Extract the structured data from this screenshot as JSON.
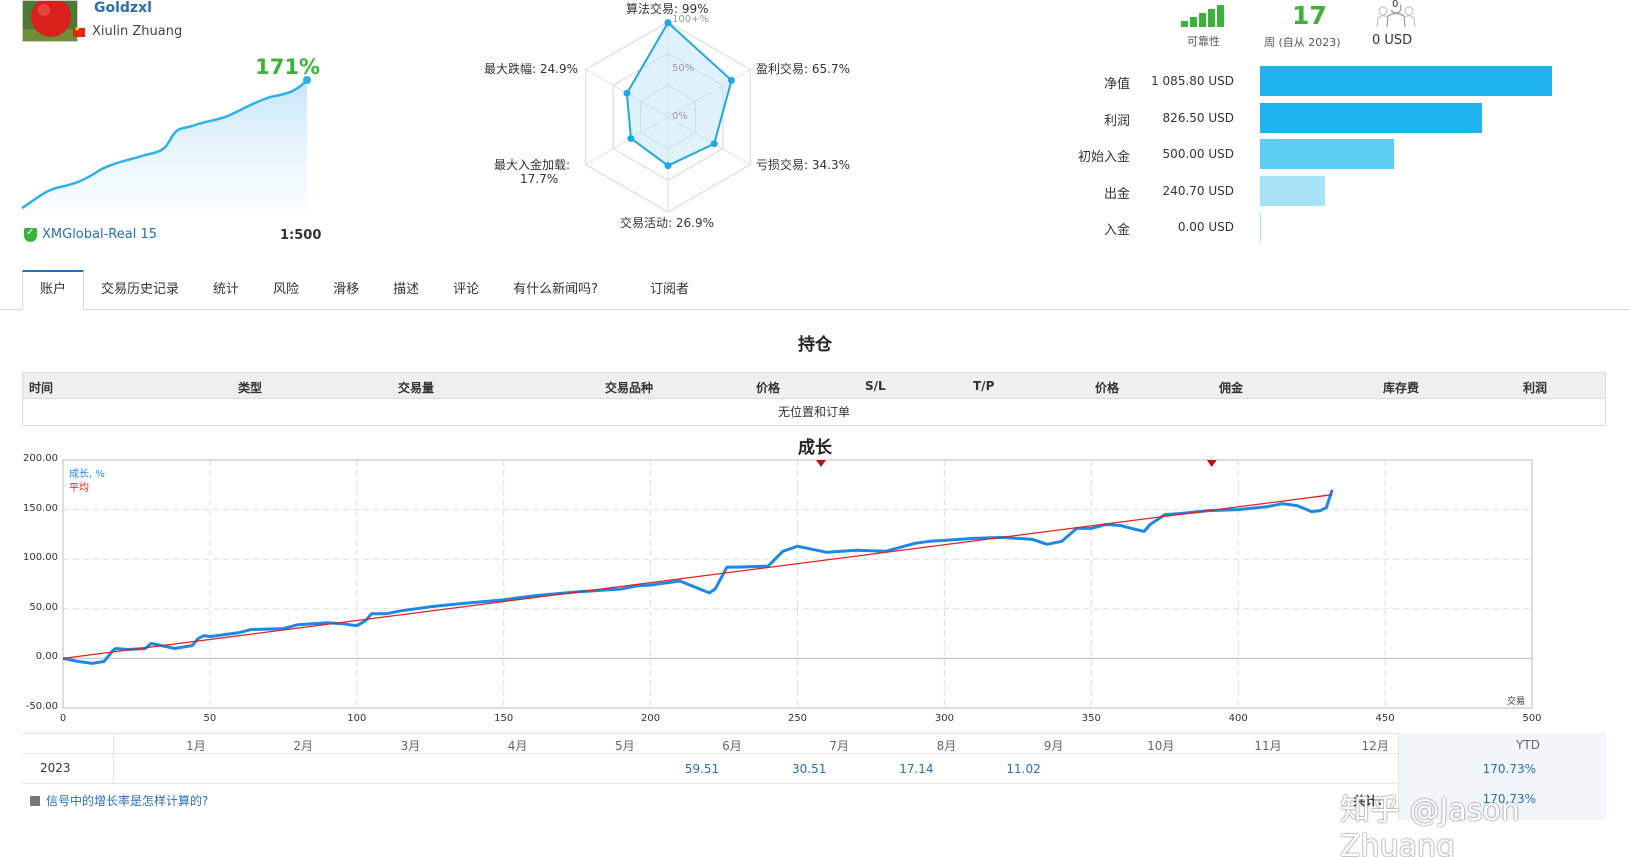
{
  "profile": {
    "nickname": "Goldzxl",
    "name": "Xiulin Zhuang",
    "growth": "171%",
    "broker": "XMGlobal-Real 15",
    "leverage": "1:500"
  },
  "radar": {
    "algo": "算法交易: 99%",
    "profit_trades": "盈利交易: 65.7%",
    "loss_trades": "亏损交易: 34.3%",
    "activity": "交易活动: 26.9%",
    "max_deposit_load_l1": "最大入金加载:",
    "max_deposit_load_l2": "17.7%",
    "max_drawdown": "最大跌幅: 24.9%",
    "scale_100": "100+%",
    "scale_50": "50%",
    "scale_0": "0%",
    "values": {
      "algo": 0.99,
      "profit_trades": 0.657,
      "loss_trades": 0.343,
      "activity": 0.269,
      "max_deposit_load": 0.177,
      "max_drawdown": 0.249
    }
  },
  "stats": {
    "reliability_label": "可靠性",
    "weeks_value": "17",
    "weeks_label": "周 (自从 2023)",
    "subscribers_count": "0",
    "subscribers_value": "0 USD"
  },
  "balance": [
    {
      "label": "净值",
      "value": "1 085.80 USD",
      "fraction": 1.0,
      "color": "#1fb4ef"
    },
    {
      "label": "利润",
      "value": "826.50 USD",
      "fraction": 0.761,
      "color": "#1fb4ef"
    },
    {
      "label": "初始入金",
      "value": "500.00 USD",
      "fraction": 0.46,
      "color": "#5ccdf3"
    },
    {
      "label": "出金",
      "value": "240.70 USD",
      "fraction": 0.222,
      "color": "#a6e3f8"
    },
    {
      "label": "入金",
      "value": "0.00 USD",
      "fraction": 0.0,
      "color": "#a6e3f8"
    }
  ],
  "tabs": [
    "账户",
    "交易历史记录",
    "统计",
    "风险",
    "滑移",
    "描述",
    "评论",
    "有什么新闻吗?",
    "订阅者"
  ],
  "positions": {
    "title": "持仓",
    "columns": [
      "时间",
      "类型",
      "交易量",
      "交易品种",
      "价格",
      "S/L",
      "T/P",
      "价格",
      "佣金",
      "库存费",
      "利润"
    ],
    "empty": "无位置和订单"
  },
  "growth_section": {
    "title": "成长",
    "legend_growth": "成长, %",
    "legend_avg": "平均",
    "x_axis_label": "交易"
  },
  "chart_data": {
    "type": "line",
    "xlabel": "交易",
    "ylabel": "",
    "xlim": [
      0,
      500
    ],
    "ylim": [
      -50,
      200
    ],
    "xticks": [
      0,
      50,
      100,
      150,
      200,
      250,
      300,
      350,
      400,
      450,
      500
    ],
    "yticks": [
      "-50.00",
      "0.00",
      "50.00",
      "100.00",
      "150.00",
      "200.00"
    ],
    "grid": true,
    "series": [
      {
        "name": "成长, %",
        "color": "#1e88e5",
        "x": [
          0,
          5,
          10,
          14,
          17,
          18,
          22,
          28,
          30,
          35,
          38,
          44,
          46,
          48,
          50,
          60,
          64,
          75,
          80,
          90,
          95,
          100,
          103,
          105,
          110,
          115,
          125,
          135,
          150,
          160,
          175,
          190,
          195,
          200,
          210,
          215,
          220,
          222,
          226,
          230,
          240,
          245,
          250,
          255,
          260,
          270,
          280,
          285,
          290,
          295,
          300,
          310,
          320,
          330,
          335,
          340,
          345,
          350,
          355,
          360,
          365,
          368,
          370,
          375,
          380,
          390,
          400,
          410,
          415,
          420,
          425,
          428,
          430,
          432
        ],
        "y": [
          0,
          -3,
          -5,
          -3,
          8,
          10,
          9,
          10,
          15,
          12,
          10,
          13,
          20,
          23,
          22,
          26,
          29,
          30,
          34,
          36,
          35,
          33,
          38,
          45,
          45,
          48,
          52,
          55,
          59,
          63,
          67,
          70,
          73,
          74,
          78,
          72,
          66,
          70,
          92,
          92,
          93,
          108,
          113,
          110,
          107,
          109,
          108,
          112,
          116,
          118,
          119,
          121,
          122,
          120,
          115,
          118,
          131,
          131,
          135,
          134,
          130,
          128,
          135,
          145,
          146,
          149,
          150,
          153,
          156,
          154,
          148,
          149,
          152,
          170
        ]
      },
      {
        "name": "平均",
        "color": "#e02020",
        "x": [
          0,
          432
        ],
        "y": [
          0,
          165
        ]
      }
    ]
  },
  "monthly": {
    "months": [
      "1月",
      "2月",
      "3月",
      "4月",
      "5月",
      "6月",
      "7月",
      "8月",
      "9月",
      "10月",
      "11月",
      "12月"
    ],
    "ytd_label": "YTD",
    "year": "2023",
    "values": [
      "",
      "",
      "",
      "",
      "",
      "59.51",
      "30.51",
      "17.14",
      "11.02",
      "",
      "",
      ""
    ],
    "ytd": "170.73%",
    "total_label": "共计:",
    "total": "170.73%"
  },
  "footer": {
    "help_link": "信号中的增长率是怎样计算的?",
    "watermark": "知乎 @Jason Zhuang"
  }
}
